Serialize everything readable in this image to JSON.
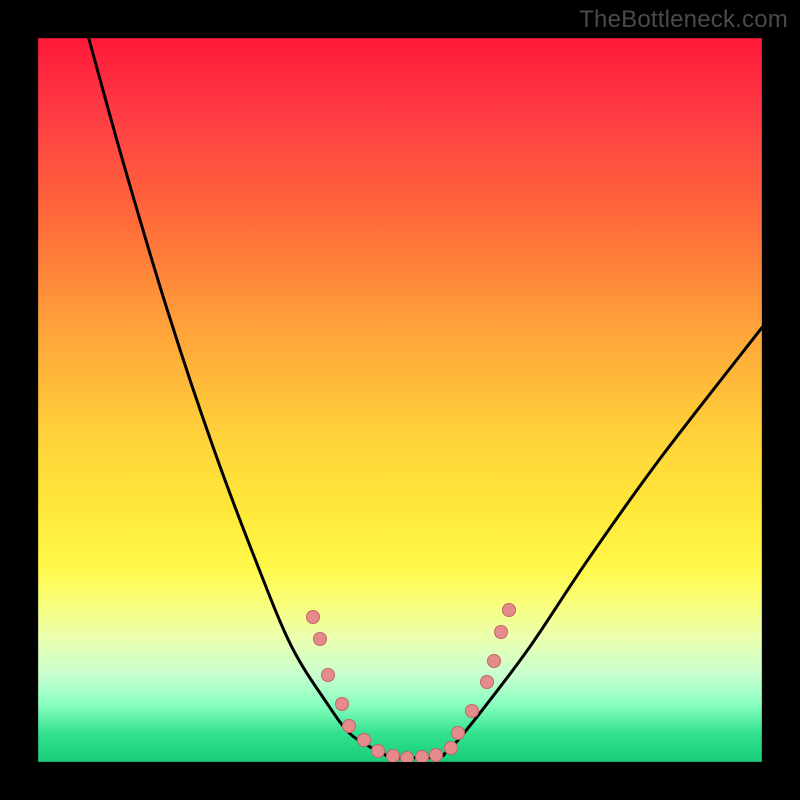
{
  "watermark": "TheBottleneck.com",
  "chart_data": {
    "type": "line",
    "title": "",
    "xlabel": "",
    "ylabel": "",
    "xlim": [
      0,
      100
    ],
    "ylim": [
      0,
      100
    ],
    "grid": false,
    "legend": false,
    "series": [
      {
        "name": "left-curve",
        "x": [
          7,
          12,
          18,
          24,
          30,
          35,
          40,
          43,
          46,
          48
        ],
        "y": [
          100,
          82,
          62,
          44,
          28,
          16,
          8,
          4,
          2,
          1
        ]
      },
      {
        "name": "bottom-flat",
        "x": [
          48,
          50,
          52,
          54,
          56
        ],
        "y": [
          1,
          0.6,
          0.6,
          0.6,
          1
        ]
      },
      {
        "name": "right-curve",
        "x": [
          56,
          58,
          62,
          68,
          76,
          86,
          100
        ],
        "y": [
          1,
          3,
          8,
          16,
          28,
          42,
          60
        ]
      }
    ],
    "markers": [
      {
        "x": 38,
        "y": 20
      },
      {
        "x": 39,
        "y": 17
      },
      {
        "x": 40,
        "y": 12
      },
      {
        "x": 42,
        "y": 8
      },
      {
        "x": 43,
        "y": 5
      },
      {
        "x": 45,
        "y": 3
      },
      {
        "x": 47,
        "y": 1.5
      },
      {
        "x": 49,
        "y": 0.8
      },
      {
        "x": 51,
        "y": 0.6
      },
      {
        "x": 53,
        "y": 0.7
      },
      {
        "x": 55,
        "y": 1
      },
      {
        "x": 57,
        "y": 2
      },
      {
        "x": 58,
        "y": 4
      },
      {
        "x": 60,
        "y": 7
      },
      {
        "x": 62,
        "y": 11
      },
      {
        "x": 63,
        "y": 14
      },
      {
        "x": 64,
        "y": 18
      },
      {
        "x": 65,
        "y": 21
      }
    ],
    "colors": {
      "curve": "#000000",
      "marker": "#e58b8b",
      "gradient_top": "#ff1a3a",
      "gradient_bottom": "#18cc7a"
    }
  }
}
